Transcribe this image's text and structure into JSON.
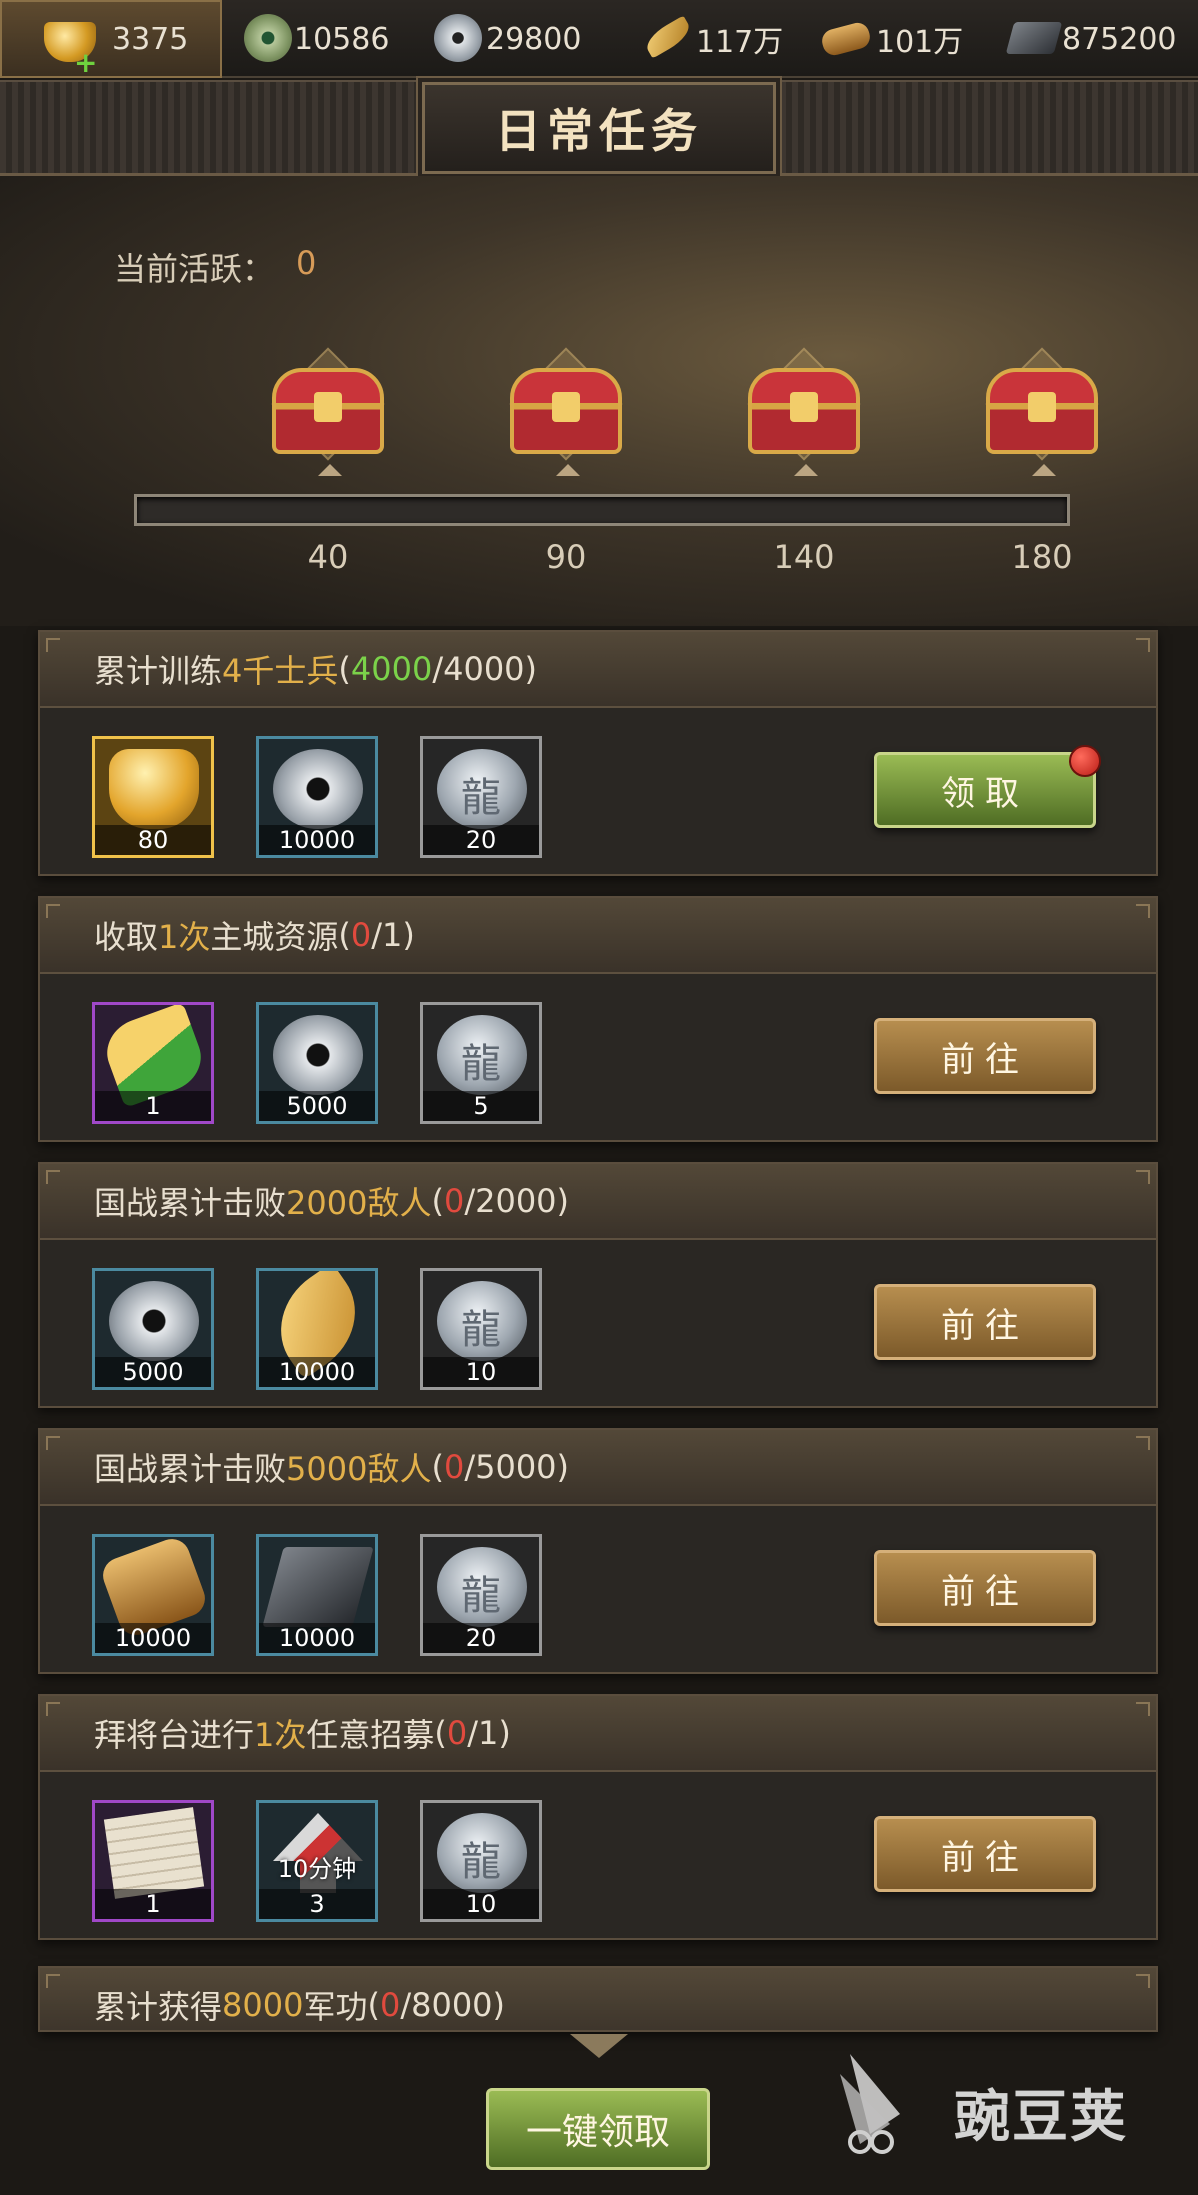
{
  "resources": [
    {
      "icon": "gold-ingot-icon",
      "value": "3375"
    },
    {
      "icon": "jade-coin-icon",
      "value": "10586"
    },
    {
      "icon": "silver-coin-icon",
      "value": "29800"
    },
    {
      "icon": "feather-icon",
      "value": "117万"
    },
    {
      "icon": "wood-log-icon",
      "value": "101万"
    },
    {
      "icon": "iron-bar-icon",
      "value": "875200"
    }
  ],
  "header": {
    "title": "日常任务"
  },
  "activity": {
    "label": "当前活跃：",
    "value": "0",
    "progress": 0
  },
  "milestones": [
    "40",
    "90",
    "140",
    "180"
  ],
  "tasks": [
    {
      "pre": "累计训练",
      "hl": "4千士兵",
      "open": "(",
      "cur": "4000",
      "sep": "/",
      "goal": "4000",
      "close": ")",
      "cur_state": "ok",
      "rewards": [
        {
          "icon": "gold-ingot-icon",
          "qty": "80",
          "rarity": "gold"
        },
        {
          "icon": "silver-coin-icon",
          "qty": "10000",
          "rarity": "blue"
        },
        {
          "icon": "dragon-coin-icon",
          "qty": "20",
          "rarity": "gray"
        }
      ],
      "button": "领取",
      "button_type": "claim"
    },
    {
      "pre": "收取",
      "hl": "1次",
      "post": "主城资源",
      "open": "(",
      "cur": "0",
      "sep": "/",
      "goal": "1",
      "close": ")",
      "cur_state": "bad",
      "rewards": [
        {
          "icon": "wheat-sickle-icon",
          "qty": "1",
          "rarity": "purple"
        },
        {
          "icon": "silver-coin-icon",
          "qty": "5000",
          "rarity": "blue"
        },
        {
          "icon": "dragon-coin-icon",
          "qty": "5",
          "rarity": "gray"
        }
      ],
      "button": "前往",
      "button_type": "goto"
    },
    {
      "pre": "国战累计击败",
      "hl": "2000敌人",
      "open": "(",
      "cur": "0",
      "sep": "/",
      "goal": "2000",
      "close": ")",
      "cur_state": "bad",
      "rewards": [
        {
          "icon": "silver-coin-icon",
          "qty": "5000",
          "rarity": "blue"
        },
        {
          "icon": "feather-icon",
          "qty": "10000",
          "rarity": "blue"
        },
        {
          "icon": "dragon-coin-icon",
          "qty": "10",
          "rarity": "gray"
        }
      ],
      "button": "前往",
      "button_type": "goto"
    },
    {
      "pre": "国战累计击败",
      "hl": "5000敌人",
      "open": "(",
      "cur": "0",
      "sep": "/",
      "goal": "5000",
      "close": ")",
      "cur_state": "bad",
      "rewards": [
        {
          "icon": "wood-log-icon",
          "qty": "10000",
          "rarity": "blue"
        },
        {
          "icon": "iron-bar-icon",
          "qty": "10000",
          "rarity": "blue"
        },
        {
          "icon": "dragon-coin-icon",
          "qty": "20",
          "rarity": "gray"
        }
      ],
      "button": "前往",
      "button_type": "goto"
    },
    {
      "pre": "拜将台进行",
      "hl": "1次",
      "post": "任意招募",
      "open": "(",
      "cur": "0",
      "sep": "/",
      "goal": "1",
      "close": ")",
      "cur_state": "bad",
      "rewards": [
        {
          "icon": "scroll-icon",
          "qty": "1",
          "rarity": "purple"
        },
        {
          "icon": "speedup-arrow-icon",
          "qty": "3",
          "overlay": "10分钟",
          "rarity": "blue"
        },
        {
          "icon": "dragon-coin-icon",
          "qty": "10",
          "rarity": "gray"
        }
      ],
      "button": "前往",
      "button_type": "goto"
    }
  ],
  "last_task": {
    "pre": "累计获得",
    "hl": "8000",
    "post": "军功",
    "open": "(",
    "cur": "0",
    "sep": "/",
    "goal": "8000",
    "close": ")"
  },
  "claim_all": "一键领取",
  "watermark": {
    "text": "豌豆荚"
  }
}
